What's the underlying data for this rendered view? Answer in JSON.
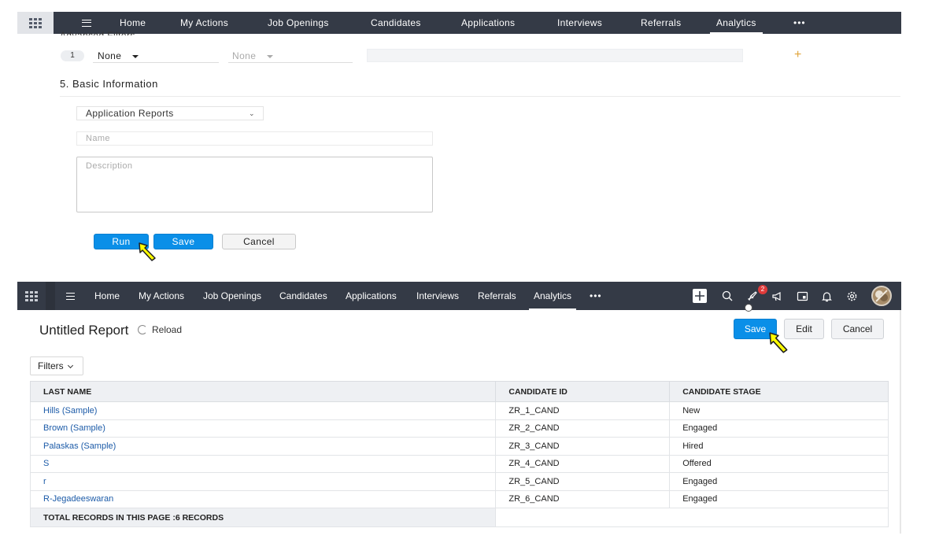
{
  "top_nav": {
    "items": [
      "Home",
      "My Actions",
      "Job Openings",
      "Candidates",
      "Applications",
      "Interviews",
      "Referrals",
      "Analytics"
    ],
    "active": "Analytics",
    "more": "•••"
  },
  "form": {
    "advanced_filters_title": "Advanced Filters",
    "criteria_index": "1",
    "field_select": "None",
    "operator_select": "None",
    "section_title": "5.  Basic Information",
    "module_select": "Application Reports",
    "name_placeholder": "Name",
    "description_placeholder": "Description",
    "run_label": "Run",
    "save_label": "Save",
    "cancel_label": "Cancel"
  },
  "nav2": {
    "items": [
      "Home",
      "My Actions",
      "Job Openings",
      "Candidates",
      "Applications",
      "Interviews",
      "Referrals",
      "Analytics"
    ],
    "active": "Analytics",
    "more": "•••",
    "notification_count": "2"
  },
  "report": {
    "title": "Untitled Report",
    "reload_label": "Reload",
    "save_label": "Save",
    "edit_label": "Edit",
    "cancel_label": "Cancel",
    "filters_label": "Filters",
    "columns": [
      "LAST NAME",
      "CANDIDATE ID",
      "CANDIDATE STAGE"
    ],
    "rows": [
      [
        "Hills (Sample)",
        "ZR_1_CAND",
        "New"
      ],
      [
        "Brown (Sample)",
        "ZR_2_CAND",
        "Engaged"
      ],
      [
        "Palaskas (Sample)",
        "ZR_3_CAND",
        "Hired"
      ],
      [
        "S",
        "ZR_4_CAND",
        "Offered"
      ],
      [
        "r",
        "ZR_5_CAND",
        "Engaged"
      ],
      [
        "R-Jegadeeswaran",
        "ZR_6_CAND",
        "Engaged"
      ]
    ],
    "total_label": "TOTAL RECORDS IN THIS PAGE :6 RECORDS"
  },
  "colors": {
    "navbar": "#343a46",
    "primary_button": "#0a8fe8",
    "link": "#1c5ba8",
    "cursor": "#ffff00"
  }
}
